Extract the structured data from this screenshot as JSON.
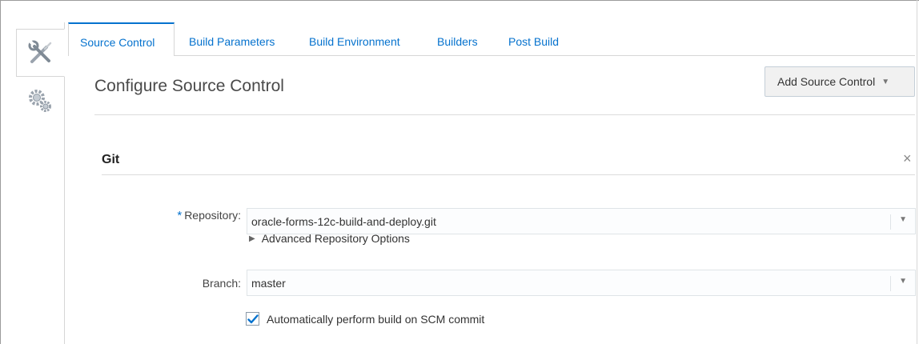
{
  "tabs": [
    {
      "label": "Source Control",
      "active": true
    },
    {
      "label": "Build Parameters",
      "active": false
    },
    {
      "label": "Build Environment",
      "active": false
    },
    {
      "label": "Builders",
      "active": false
    },
    {
      "label": "Post Build",
      "active": false
    }
  ],
  "side_tabs": [
    {
      "icon": "tools-icon",
      "active": true
    },
    {
      "icon": "gears-icon",
      "active": false
    }
  ],
  "page": {
    "title": "Configure Source Control",
    "add_button_label": "Add Source Control"
  },
  "git": {
    "section_title": "Git",
    "close_symbol": "×",
    "repository": {
      "required_marker": "*",
      "label": "Repository:",
      "value": "oracle-forms-12c-build-and-deploy.git"
    },
    "advanced_options_label": "Advanced Repository Options",
    "branch": {
      "label": "Branch:",
      "value": "master"
    },
    "auto_build": {
      "label": "Automatically perform build on SCM commit",
      "checked": true
    }
  },
  "colors": {
    "accent": "#0572ce",
    "border": "#d6d6d6",
    "button_bg": "#f1f1f1"
  }
}
